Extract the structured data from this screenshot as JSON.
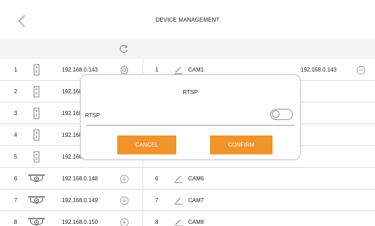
{
  "header": {
    "title": "DEVICE MANAGEMENT",
    "back_icon": "chevron-left-icon"
  },
  "toolbar": {
    "refresh_icon": "refresh-icon"
  },
  "devices": [
    {
      "num": "1",
      "type": "nvr",
      "ip": "192.168.0.143",
      "action": "settings"
    },
    {
      "num": "2",
      "type": "nvr",
      "ip": "192.168.",
      "action": ""
    },
    {
      "num": "3",
      "type": "nvr",
      "ip": "192.168.",
      "action": ""
    },
    {
      "num": "4",
      "type": "nvr",
      "ip": "192.168.",
      "action": ""
    },
    {
      "num": "5",
      "type": "nvr",
      "ip": "192.168.",
      "action": ""
    },
    {
      "num": "6",
      "type": "camera",
      "ip": "192.168.0.148",
      "action": "add"
    },
    {
      "num": "7",
      "type": "camera",
      "ip": "192.168.0.149",
      "action": "add"
    },
    {
      "num": "8",
      "type": "camera",
      "ip": "192.168.0.150",
      "action": "add"
    }
  ],
  "channels": [
    {
      "num": "1",
      "name": "CAM1",
      "ip": "192.168.0.143",
      "remove": true
    },
    {
      "num": "",
      "name": "",
      "ip": "",
      "remove": false
    },
    {
      "num": "",
      "name": "",
      "ip": "",
      "remove": false
    },
    {
      "num": "",
      "name": "",
      "ip": "",
      "remove": false
    },
    {
      "num": "",
      "name": "",
      "ip": "",
      "remove": false
    },
    {
      "num": "6",
      "name": "CAM6",
      "ip": "",
      "remove": false
    },
    {
      "num": "7",
      "name": "CAM7",
      "ip": "",
      "remove": false
    },
    {
      "num": "8",
      "name": "CAM8",
      "ip": "",
      "remove": false
    }
  ],
  "dialog": {
    "title": "RTSP",
    "toggle_label": "RTSP",
    "toggle_on": false,
    "cancel_label": "CANCEL",
    "confirm_label": "CONFIRM"
  },
  "colors": {
    "accent": "#f0932b",
    "toolbar_bg": "#f3f3f3",
    "divider": "#dcdcdc"
  }
}
